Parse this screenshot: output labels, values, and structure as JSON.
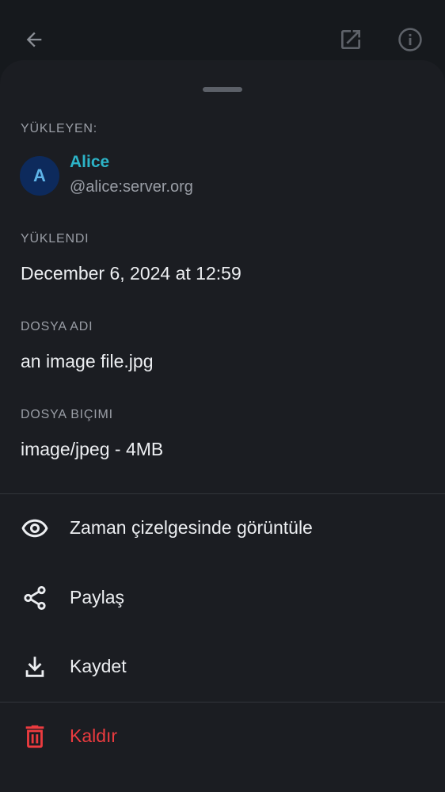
{
  "uploader": {
    "label": "YÜKLEYEN:",
    "avatar_initial": "A",
    "name": "Alice",
    "user_id": "@alice:server.org"
  },
  "uploaded": {
    "label": "YÜKLENDI",
    "value": "December 6, 2024 at 12:59"
  },
  "file_name": {
    "label": "DOSYA ADI",
    "value": "an image file.jpg"
  },
  "file_format": {
    "label": "DOSYA BIÇIMI",
    "value": "image/jpeg - 4MB"
  },
  "actions": [
    {
      "label": "Zaman çizelgesinde görüntüle",
      "icon": "eye-icon"
    },
    {
      "label": "Paylaş",
      "icon": "share-icon"
    },
    {
      "label": "Kaydet",
      "icon": "download-icon"
    },
    {
      "label": "Kaldır",
      "icon": "trash-icon"
    }
  ],
  "topbar": {
    "icons": [
      "back-arrow-icon",
      "open-external-icon",
      "info-icon"
    ]
  },
  "colors": {
    "accent": "#2cb3c7",
    "danger": "#ec3b3f",
    "sheet_bg": "#1b1d22"
  }
}
